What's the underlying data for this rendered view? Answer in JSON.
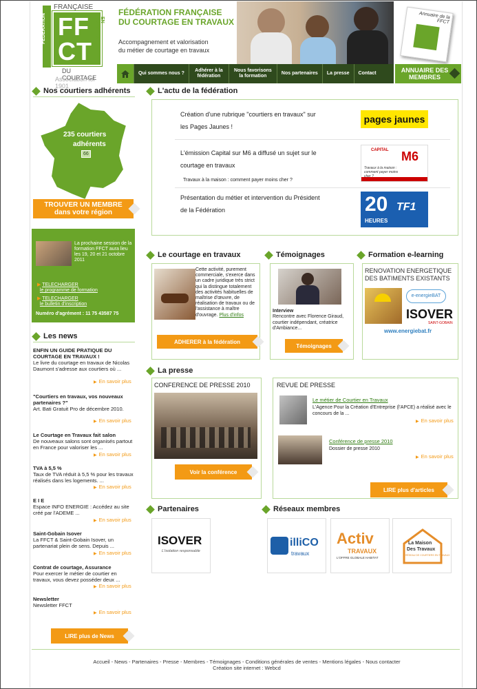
{
  "logo": {
    "top": "FRANÇAISE",
    "side_left": "FÉDÉRATION",
    "ff": "FF",
    "ct": "CT",
    "side_right": "EN TRAVAUX",
    "bottom": "DU COURTAGE",
    "assoc": "Association loi 1901"
  },
  "header": {
    "title1": "FÉDÉRATION FRANÇAISE",
    "title2": "DU COURTAGE EN TRAVAUX",
    "tag1": "Accompagnement et valorisation",
    "tag2": "du métier de courtage en travaux",
    "annuaire_small": "Annuaire de la FFCT",
    "annuaire_label": "ANNUAIRE DES MEMBRES"
  },
  "nav": {
    "items": [
      "Qui sommes nous ?",
      "Adhérer à la fédération",
      "Nous favorisons la formation",
      "Nos partenaires",
      "La presse",
      "Contact"
    ]
  },
  "sidebar": {
    "courtiers_title": "Nos courtiers adhérents",
    "map_count": "235 courtiers",
    "map_label": "adhérents",
    "map_badge": "66",
    "trouver1": "TROUVER UN MEMBRE",
    "trouver2": "dans votre région",
    "formation_text": "La prochaine session de la formation FFCT aura lieu les 19, 20 et 21 octobre 2011",
    "dl1a": "TELECHARGER",
    "dl1b": "le programme de formation",
    "dl2a": "TELECHARGER",
    "dl2b": "le bulletin d'inscription",
    "agrement": "Numéro d'agrément : 11 75 43587 75",
    "news_title": "Les news",
    "news": [
      {
        "title": "ENFIN UN GUIDE PRATIQUE DU COURTAGE EN TRAVAUX !",
        "body": "Le livre du courtage en travaux de Nicolas Daumont s'adresse aux courtiers où ..."
      },
      {
        "title": "\"Courtiers en travaux, vos nouveaux partenaires ?\"",
        "body": "Art. Bati Gratuit Pro de décembre 2010."
      },
      {
        "title": "Le Courtage en Travaux fait salon",
        "body": "De nouveaux salons sont organisés partout en France pour valoriser les ..."
      },
      {
        "title": "TVA à 5,5 %",
        "body": "Taux de TVA réduit à 5,5 % pour les travaux réalisés dans les logements. ..."
      },
      {
        "title": "E I E",
        "body": "Espace INFO ENERGIE : Accédez au site créé par l'ADEME ..."
      },
      {
        "title": "Saint-Gobain Isover",
        "body": "La FFCT & Saint-Gobain Isover, un partenariat plein de sens. Depuis ..."
      },
      {
        "title": "Contrat de courtage, Assurance",
        "body": "Pour exercer le métier de courtier en travaux, vous devez posséder deux ..."
      },
      {
        "title": "Newsletter",
        "body": "Newsletter FFCT"
      }
    ],
    "more": "En savoir plus",
    "lire_news": "LIRE plus de News"
  },
  "actu": {
    "title": "L'actu de la fédération",
    "items": [
      {
        "text": "Création d'une rubrique \"courtiers en travaux\" sur les Pages Jaunes !",
        "logo": "pagesjaunes",
        "sub": ""
      },
      {
        "text": "L'émission Capital sur M6 a diffusé un sujet sur le courtage en travaux",
        "logo": "M6",
        "sub": "Travaux à la maison : comment payer moins cher ?"
      },
      {
        "text": "Présentation du métier et intervention du Président de la Fédération",
        "logo": "20 HEURES TF1",
        "sub": ""
      }
    ],
    "pj1": "pages",
    "pj2": "jaunes",
    "capital": "CAPITAL",
    "m6": "M6",
    "capital_sub": "Travaux à la maison : comment payer moins cher ?",
    "tf_20": "20",
    "tf_heures": "HEURES",
    "tf1": "TF1"
  },
  "courtage": {
    "title": "Le courtage en travaux",
    "text": "Cette activité, purement commerciale, s'exerce dans un cadre juridique très strict qui la distingue totalement des activités habituelles de maîtrise d'œuvre, de réalisation de travaux ou de l'assistance à maître d'ouvrage.",
    "link": "Plus d'infos",
    "btn": "ADHERER à la fédération"
  },
  "temoignages": {
    "title": "Témoignages",
    "label": "Interview",
    "text": "Rencontre avec Florence Giraud, courtier indépendant, créatrice d'Ambiance...",
    "btn": "Témoignages"
  },
  "elearning": {
    "title": "Formation e-learning",
    "heading": "RENOVATION ENERGETIQUE DES BATIMENTS EXISTANTS",
    "energie": "e-energieBAT",
    "isover": "ISOVER",
    "isover_sub": "SAINT-GOBAIN",
    "url": "www.energiebat.fr"
  },
  "presse": {
    "title": "La presse",
    "conf_title": "CONFERENCE DE PRESSE 2010",
    "conf_btn": "Voir la conférence",
    "revue_title": "REVUE DE PRESSE",
    "r1_link": "Le métier de Courtier en Travaux",
    "r1_text": "L'Agence Pour la Création d'Entreprise (l'APCE) a réalisé avec le concours de la ...",
    "r2_link": "Conférence de presse 2010",
    "r2_text": "Dossier de presse 2010",
    "more": "En savoir plus",
    "lire": "LIRE plus d'articles"
  },
  "partenaires": {
    "title": "Partenaires",
    "isover": "ISOVER",
    "isover_sub": "L'isolation responsable"
  },
  "reseaux": {
    "title": "Réseaux membres",
    "illico": "illiCO",
    "illico_sub": "travaux",
    "activ": "Activ",
    "activ_sub": "TRAVAUX",
    "activ_sub2": "L'OFFRE GLOBALE HABITAT",
    "maison1": "La Maison",
    "maison2": "Des Travaux",
    "maison_sub": "RÉSEAU DE COURTIERS EN TRAVAUX"
  },
  "footer": {
    "links": "Accueil - News - Partenaires - Presse - Membres - Témoignages - Conditions générales de ventes - Mentions légales - Nous contacter",
    "credit": "Création site internet : Webcd"
  },
  "colors": {
    "green": "#6aa52a",
    "orange": "#f39a15",
    "dark": "#2f4a1d"
  }
}
